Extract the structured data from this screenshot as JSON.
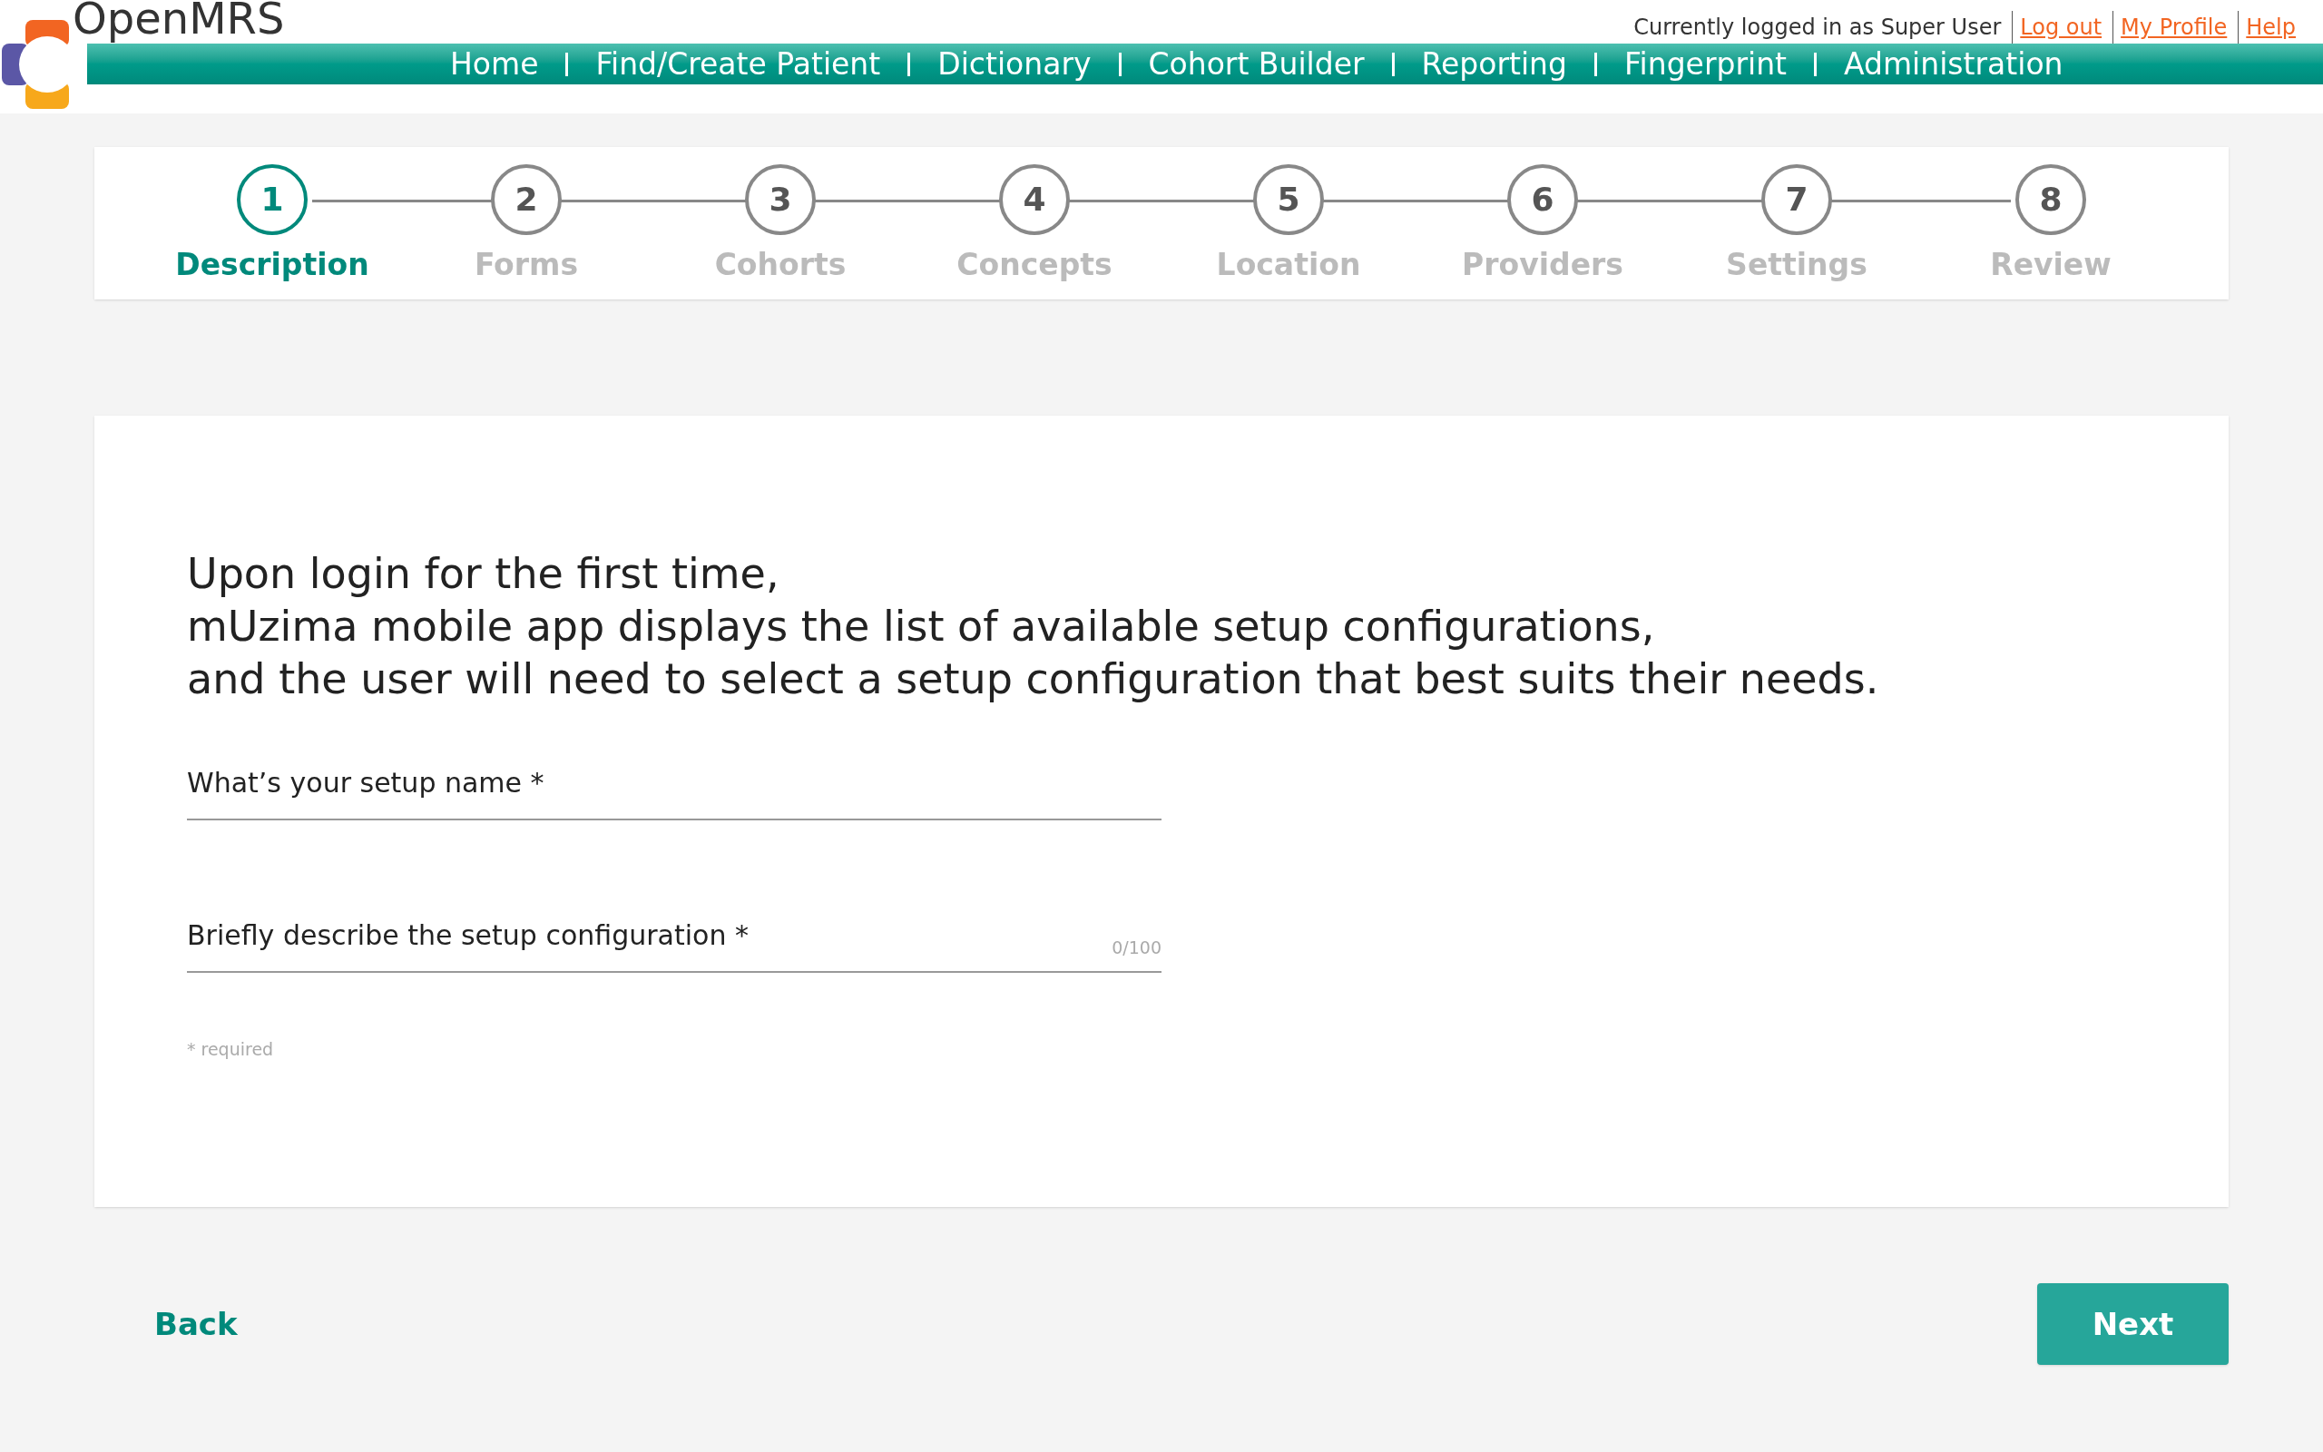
{
  "header": {
    "logo_text": "OpenMRS",
    "user_status": "Currently logged in as Super User",
    "user_links": [
      "Log out",
      "My Profile",
      "Help"
    ],
    "nav": [
      "Home",
      "Find/Create Patient",
      "Dictionary",
      "Cohort Builder",
      "Reporting",
      "Fingerprint",
      "Administration"
    ]
  },
  "stepper": [
    {
      "number": "1",
      "label": "Description",
      "selected": true
    },
    {
      "number": "2",
      "label": "Forms",
      "selected": false
    },
    {
      "number": "3",
      "label": "Cohorts",
      "selected": false
    },
    {
      "number": "4",
      "label": "Concepts",
      "selected": false
    },
    {
      "number": "5",
      "label": "Location",
      "selected": false
    },
    {
      "number": "6",
      "label": "Providers",
      "selected": false
    },
    {
      "number": "7",
      "label": "Settings",
      "selected": false
    },
    {
      "number": "8",
      "label": "Review",
      "selected": false
    }
  ],
  "intro": [
    "Upon login for the first time,",
    "mUzima mobile app displays the list of available setup configurations,",
    "and the user will need to select a setup configuration that best suits their needs."
  ],
  "fields": [
    {
      "placeholder": "What’s your setup name *"
    },
    {
      "placeholder": "Briefly describe the setup configuration *",
      "counter": "0/100"
    }
  ],
  "required_note": "* required",
  "buttons": {
    "back": "Back",
    "next": "Next"
  }
}
